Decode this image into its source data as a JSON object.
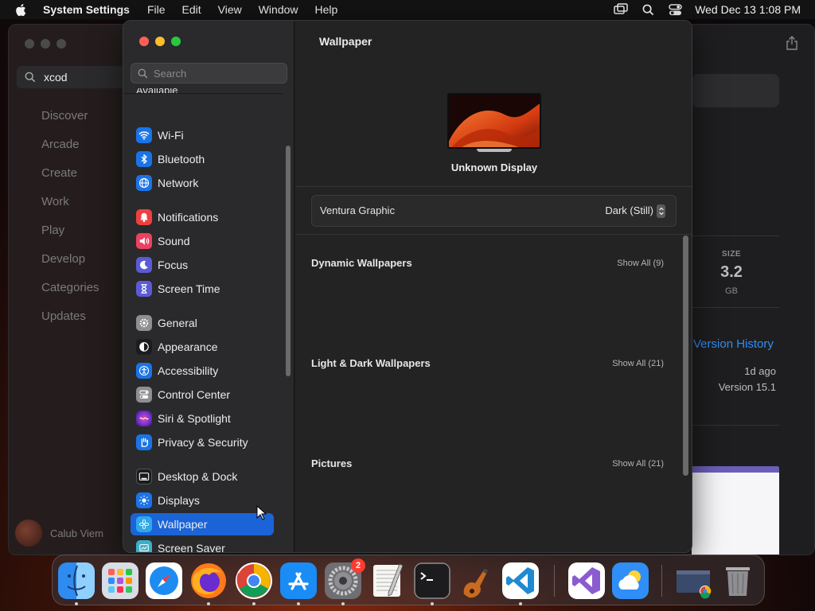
{
  "menubar": {
    "app_name": "System Settings",
    "items": [
      "File",
      "Edit",
      "View",
      "Window",
      "Help"
    ],
    "clock": "Wed Dec 13  1:08 PM",
    "status_icons": [
      "screen-mirroring-icon",
      "spotlight-icon",
      "control-center-icon"
    ]
  },
  "app_store": {
    "search_value": "xcod",
    "nav": [
      "Discover",
      "Arcade",
      "Create",
      "Work",
      "Play",
      "Develop",
      "Categories",
      "Updates"
    ],
    "user_name": "Calub Viem",
    "size_label": "SIZE",
    "size_value": "3.2",
    "size_unit": "GB",
    "version_history": "Version History",
    "updated_ago": "1d ago",
    "version": "Version 15.1"
  },
  "settings": {
    "search_placeholder": "Search",
    "cut_off_item": "Available",
    "groups": [
      [
        {
          "label": "Wi-Fi",
          "icon": "wifi-icon",
          "color": "#1a74e8"
        },
        {
          "label": "Bluetooth",
          "icon": "bluetooth-icon",
          "color": "#1a74e8"
        },
        {
          "label": "Network",
          "icon": "globe-icon",
          "color": "#1a74e8"
        }
      ],
      [
        {
          "label": "Notifications",
          "icon": "bell-icon",
          "color": "#ee4040"
        },
        {
          "label": "Sound",
          "icon": "speaker-icon",
          "color": "#ee4060"
        },
        {
          "label": "Focus",
          "icon": "moon-icon",
          "color": "#5b5bd6"
        },
        {
          "label": "Screen Time",
          "icon": "hourglass-icon",
          "color": "#5b5bd6"
        }
      ],
      [
        {
          "label": "General",
          "icon": "gear-icon",
          "color": "#8e8e93"
        },
        {
          "label": "Appearance",
          "icon": "appearance-icon",
          "color": "#1c1c1e"
        },
        {
          "label": "Accessibility",
          "icon": "accessibility-icon",
          "color": "#1a74e8"
        },
        {
          "label": "Control Center",
          "icon": "toggles-icon",
          "color": "#8e8e93"
        },
        {
          "label": "Siri & Spotlight",
          "icon": "siri-icon",
          "color": "#8a3ab9"
        },
        {
          "label": "Privacy & Security",
          "icon": "hand-icon",
          "color": "#1a74e8"
        }
      ],
      [
        {
          "label": "Desktop & Dock",
          "icon": "dock-icon",
          "color": "#1c1c1e"
        },
        {
          "label": "Displays",
          "icon": "sun-icon",
          "color": "#1a74e8"
        },
        {
          "label": "Wallpaper",
          "icon": "flower-icon",
          "color": "#2fa8e8",
          "selected": true
        },
        {
          "label": "Screen Saver",
          "icon": "screensaver-icon",
          "color": "#3ab0c8"
        }
      ]
    ],
    "pane": {
      "title": "Wallpaper",
      "display_name": "Unknown Display",
      "wallpaper_name": "Ventura Graphic",
      "wallpaper_mode": "Dark (Still)",
      "sections": [
        {
          "title": "Dynamic Wallpapers",
          "show_all": "Show All (9)"
        },
        {
          "title": "Light & Dark Wallpapers",
          "show_all": "Show All (21)"
        },
        {
          "title": "Pictures",
          "show_all": "Show All (21)"
        }
      ]
    }
  },
  "dock": {
    "apps": [
      "Finder",
      "Launchpad",
      "Safari",
      "Firefox",
      "Google Chrome",
      "App Store",
      "System Settings",
      "TextEdit",
      "Terminal",
      "Instruments",
      "Visual Studio Code",
      "Visual Studio",
      "Weather",
      "Chrome Window",
      "Trash"
    ],
    "settings_badge": "2",
    "accent_colors": {
      "selection": "#1a64d8",
      "link": "#2f8ef7",
      "badge": "#ff3b30"
    }
  }
}
